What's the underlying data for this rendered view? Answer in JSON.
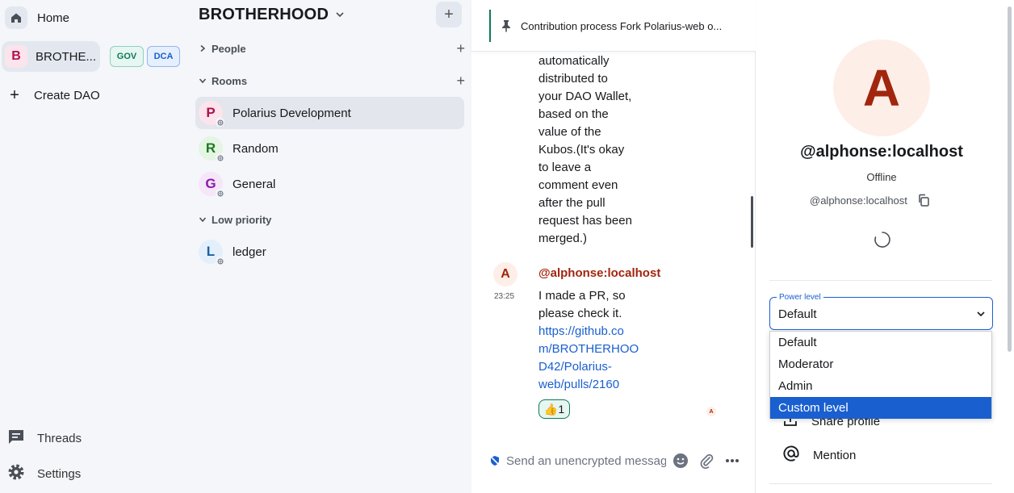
{
  "colors": {
    "accent": "#1a5fd0",
    "brand_green": "#0d7a5a",
    "sender_color": "#a1260d",
    "avatar_bg": "#fdeee8"
  },
  "spacebar": {
    "home_label": "Home",
    "space_initial": "B",
    "space_name": "BROTHE...",
    "badges": [
      "GOV",
      "DCA"
    ],
    "create_label": "Create DAO",
    "threads_label": "Threads",
    "settings_label": "Settings"
  },
  "roomlist": {
    "title": "BROTHERHOOD",
    "sections": {
      "people": "People",
      "rooms": "Rooms",
      "low_priority": "Low priority"
    },
    "rooms": [
      {
        "initial": "P",
        "name": "Polarius Development",
        "color": "#b0114e",
        "bg": "#fce4ec"
      },
      {
        "initial": "R",
        "name": "Random",
        "color": "#1e7a1e",
        "bg": "#e4f5e4"
      },
      {
        "initial": "G",
        "name": "General",
        "color": "#8a1aa8",
        "bg": "#f5e6fa"
      }
    ],
    "low_priority_rooms": [
      {
        "initial": "L",
        "name": "ledger",
        "color": "#1a5fa8",
        "bg": "#e3f0fb"
      }
    ]
  },
  "timeline": {
    "pinned_text": "Contribution process Fork Polarius-web o...",
    "prev_message_lines": [
      "automatically",
      "distributed to",
      "your DAO Wallet,",
      "based on the",
      "value of the",
      "Kubos.(It's okay",
      "to leave a",
      "comment even",
      "after the pull",
      "request has been",
      "merged.)"
    ],
    "message": {
      "avatar_initial": "A",
      "time": "23:25",
      "sender": "@alphonse:localhost",
      "text_lines": [
        "I made a PR, so",
        "please check it."
      ],
      "link_lines": [
        "https://github.co",
        "m/BROTHERHOO",
        "D42/Polarius-",
        "web/pulls/2160"
      ],
      "reaction_emoji": "👍",
      "reaction_count": "1",
      "receipt_initial": "A"
    },
    "composer_placeholder": "Send an unencrypted message..."
  },
  "rightpanel": {
    "avatar_initial": "A",
    "display_name": "@alphonse:localhost",
    "presence": "Offline",
    "user_id": "@alphonse:localhost",
    "power_level_label": "Power level",
    "power_level_value": "Default",
    "power_level_options": [
      "Default",
      "Moderator",
      "Admin",
      "Custom level"
    ],
    "selected_option_index": 3,
    "actions": [
      "Share profile",
      "Mention"
    ]
  }
}
